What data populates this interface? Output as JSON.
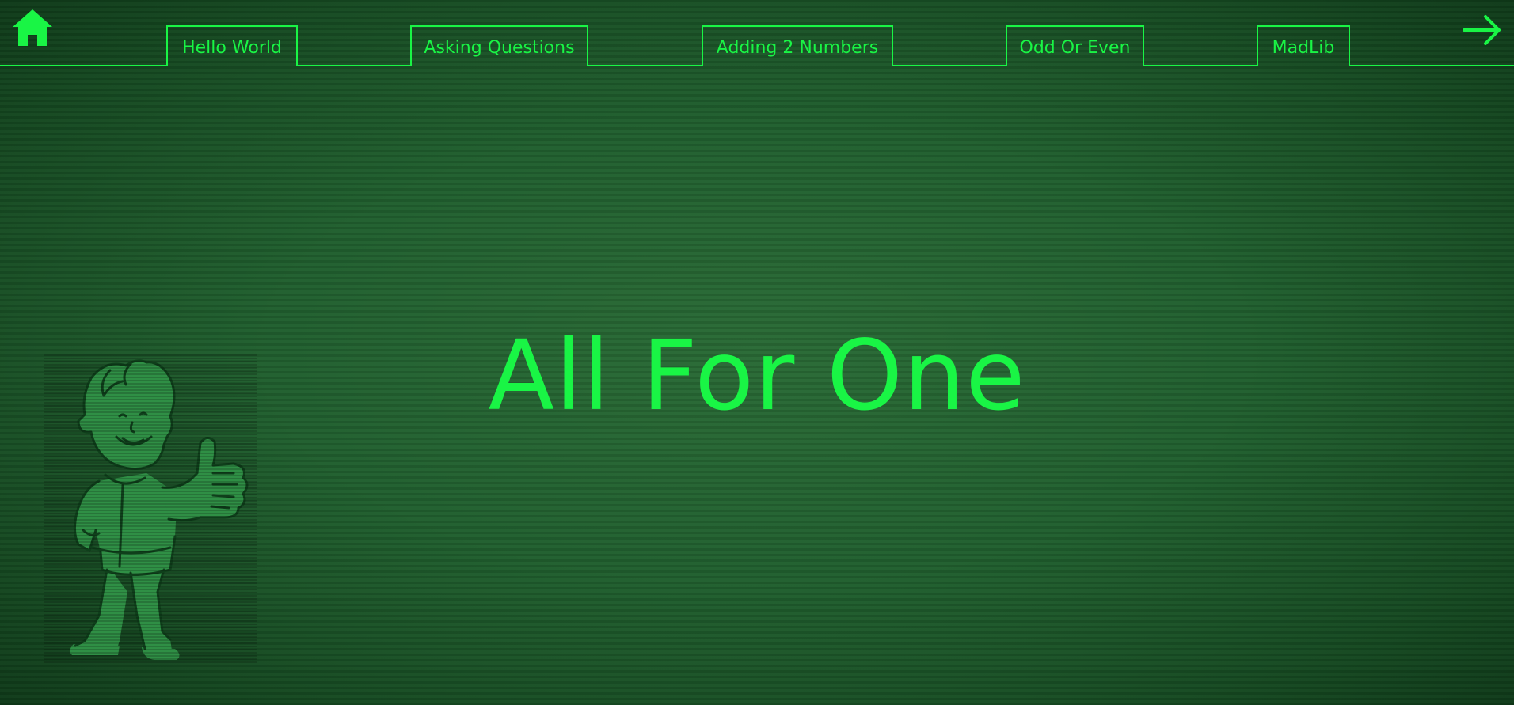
{
  "colors": {
    "accent": "#19f545",
    "background": "#1e5a2b",
    "mascot_fill": "#2f8f45",
    "mascot_line": "#0f3f1b"
  },
  "nav": {
    "home_icon": "home-icon",
    "next_icon": "arrow-right-icon",
    "tabs": [
      {
        "label": "Hello World"
      },
      {
        "label": "Asking Questions"
      },
      {
        "label": "Adding 2 Numbers"
      },
      {
        "label": "Odd Or Even"
      },
      {
        "label": "MadLib"
      }
    ]
  },
  "main": {
    "title": "All For One",
    "mascot": "thumbs-up-mascot"
  }
}
